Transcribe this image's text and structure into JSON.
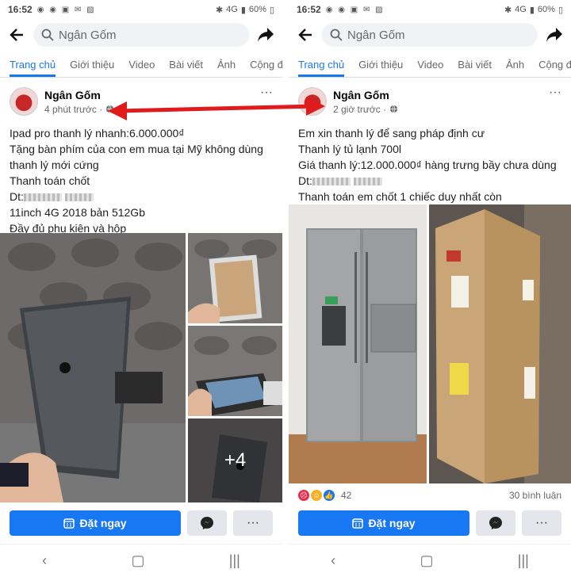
{
  "left": {
    "status": {
      "time": "16:52",
      "battery": "60%",
      "net": "4G"
    },
    "search": {
      "text": "Ngân Gốm"
    },
    "tabs": [
      "Trang chủ",
      "Giới thiệu",
      "Video",
      "Bài viết",
      "Ảnh",
      "Cộng đồ"
    ],
    "post": {
      "name": "Ngân Gốm",
      "time": "4 phút trước ·",
      "lines": [
        "Ipad pro thanh lý nhanh:6.000.000₫",
        "Tặng bàn phím của con em mua tại Mỹ không dùng",
        "thanh lý mới cứng",
        "Thanh toán chốt",
        "Dt:",
        "11inch 4G 2018 bản 512Gb",
        "Đầy đủ phụ kiện và hộp"
      ],
      "more_photos": "+4"
    },
    "actions": {
      "book": "Đặt ngay",
      "more": "···"
    }
  },
  "right": {
    "status": {
      "time": "16:52",
      "battery": "60%",
      "net": "4G"
    },
    "search": {
      "text": "Ngân Gốm"
    },
    "tabs": [
      "Trang chủ",
      "Giới thiệu",
      "Video",
      "Bài viết",
      "Ảnh",
      "Cộng đồ"
    ],
    "post": {
      "name": "Ngân Gốm",
      "time": "2 giờ trước ·",
      "lines": [
        "Em xin thanh lý để sang pháp định cư",
        "Thanh lý tủ lạnh 700l",
        "Giá thanh lý:12.000.000₫ hàng trưng bầy chưa dùng",
        "Dt:",
        "Thanh toán em chốt 1 chiếc duy nhất còn"
      ]
    },
    "reactions": {
      "count": "42",
      "comments": "30 bình luận"
    },
    "actions": {
      "book": "Đặt ngay",
      "more": "···"
    }
  },
  "colors": {
    "accent": "#1877f2",
    "arrow": "#e01b1b"
  },
  "icons": [
    "back-arrow-icon",
    "search-icon",
    "share-icon",
    "globe-icon",
    "messenger-icon",
    "calendar-icon"
  ]
}
